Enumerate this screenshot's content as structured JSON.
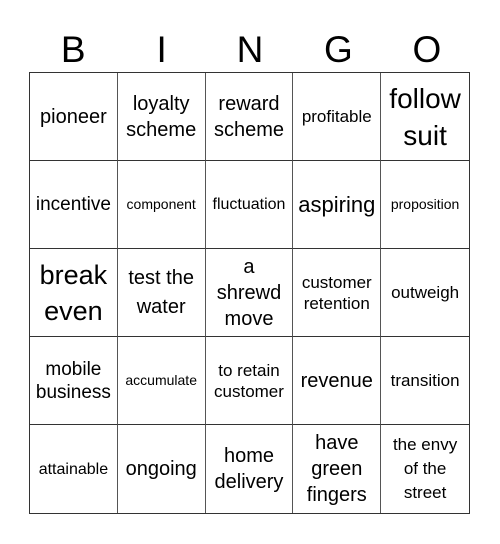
{
  "header": {
    "letters": [
      "B",
      "I",
      "N",
      "G",
      "O"
    ]
  },
  "cells": [
    {
      "text": "pioneer"
    },
    {
      "text": "loyalty scheme"
    },
    {
      "text": "reward scheme"
    },
    {
      "text": "profitable"
    },
    {
      "text": "follow suit"
    },
    {
      "text": "incentive"
    },
    {
      "text": "component"
    },
    {
      "text": "fluctuation"
    },
    {
      "text": "aspiring"
    },
    {
      "text": "proposition"
    },
    {
      "text": "break even"
    },
    {
      "text": "test the water"
    },
    {
      "text": "a shrewd move"
    },
    {
      "text": "customer retention"
    },
    {
      "text": "outweigh"
    },
    {
      "text": "mobile business"
    },
    {
      "text": "accumulate"
    },
    {
      "text": "to retain customer"
    },
    {
      "text": "revenue"
    },
    {
      "text": "transition"
    },
    {
      "text": "attainable"
    },
    {
      "text": "ongoing"
    },
    {
      "text": "home delivery"
    },
    {
      "text": "have green fingers"
    },
    {
      "text": "the envy of the street"
    }
  ]
}
